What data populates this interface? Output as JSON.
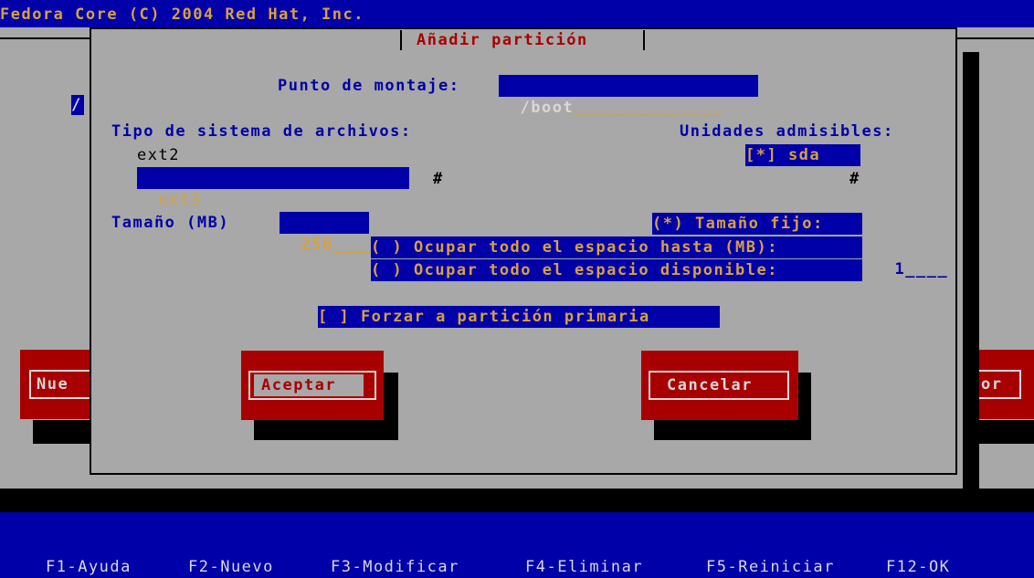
{
  "header": {
    "title": "Fedora Core (C) 2004 Red Hat, Inc."
  },
  "dialog": {
    "title": "Añadir partición",
    "mount_label": "Punto de montaje:",
    "mount_value": "/boot",
    "mount_fill": "______________",
    "fs_label": "Tipo de sistema de archivos:",
    "fs_options": [
      "ext2",
      "ext3"
    ],
    "fs_selected": "ext3",
    "drives_label": "Unidades admisibles:",
    "drive_item": "[*] sda",
    "scroll_marker": "#",
    "size_label": "Tamaño (MB)",
    "size_value": "256",
    "size_fill": "____",
    "radio_fixed": "(*) Tamaño fijo:",
    "radio_upto": "( ) Ocupar todo el espacio hasta (MB):",
    "radio_upto_value": "1",
    "radio_upto_fill": "____",
    "radio_all": "( ) Ocupar todo el espacio disponible:",
    "force_primary": "[ ] Forzar a partición primaria",
    "ok_button": "Aceptar",
    "cancel_button": "Cancelar"
  },
  "background": {
    "left_button_fragment": "Nue",
    "right_button_fragment": "or",
    "left_marker": "/"
  },
  "footer": {
    "keys": [
      "F1-Ayuda",
      "F2-Nuevo",
      "F3-Modificar",
      "F4-Eliminar",
      "F5-Reiniciar",
      "F12-OK"
    ]
  },
  "colors": {
    "screen_blue": "#0000a8",
    "dialog_gray": "#a8a8a8",
    "button_red": "#a80000",
    "field_text_orange": "#d8a040"
  }
}
